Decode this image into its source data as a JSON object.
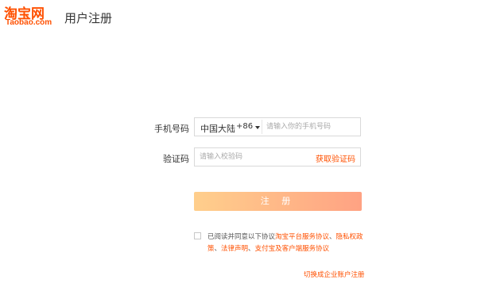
{
  "header": {
    "logo_cn": "淘宝网",
    "logo_en": "Taobao.com",
    "title": "用户注册"
  },
  "form": {
    "phone_label": "手机号码",
    "region": "中国大陆",
    "country_code": "+86",
    "phone_placeholder": "请输入你的手机号码",
    "sms_label": "验证码",
    "sms_placeholder": "请输入校验码",
    "get_code": "获取验证码",
    "register": "注 册"
  },
  "agreement": {
    "prefix": "已阅读并同意以下协议",
    "link1": "淘宝平台服务协议",
    "sep1": "、",
    "link2": "隐私权政策",
    "sep2": "、",
    "link3": "法律声明",
    "sep3": "、",
    "link4": "支付宝及客户端服务协议"
  },
  "footer": {
    "switch_link": "切换成企业账户注册"
  },
  "colors": {
    "brand": "#ff5000",
    "button_gradient_start": "#ffcf8c",
    "button_gradient_end": "#ffa283"
  }
}
